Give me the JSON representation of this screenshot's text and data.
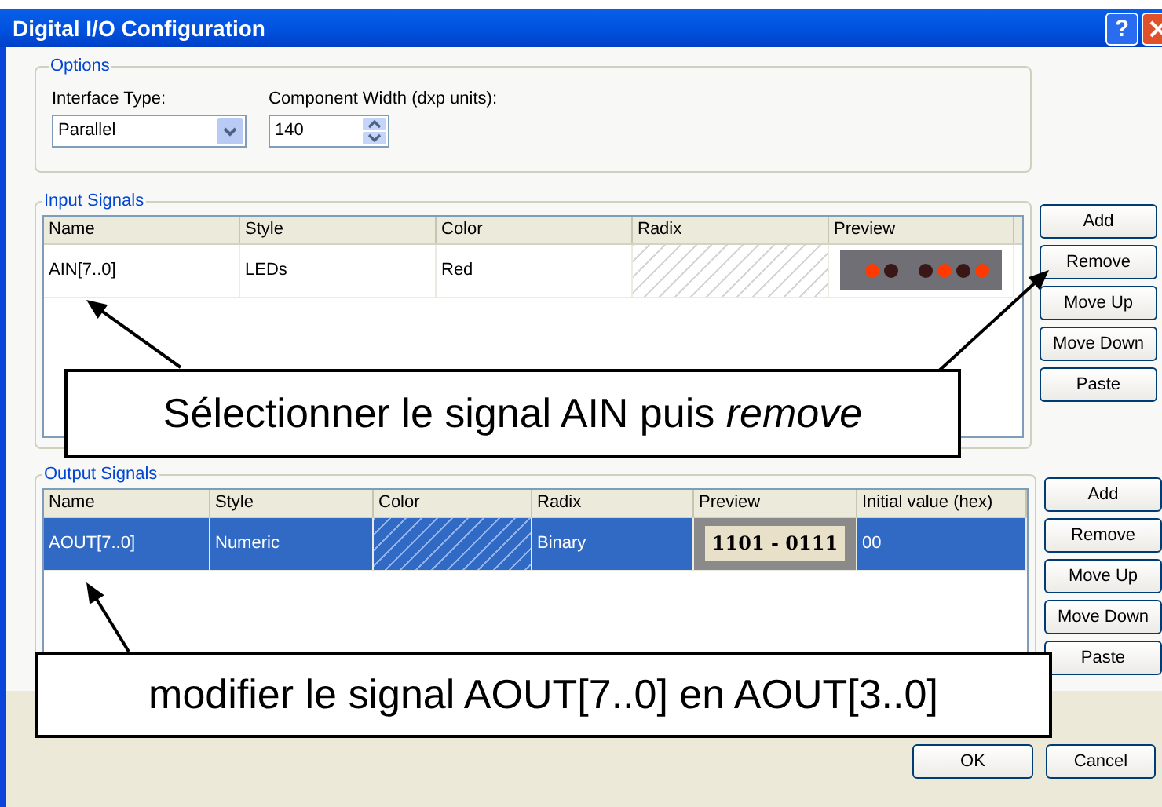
{
  "window": {
    "title": "Digital I/O Configuration",
    "help": "?"
  },
  "options": {
    "title": "Options",
    "interface_type": {
      "label": "Interface Type:",
      "value": "Parallel"
    },
    "component_width": {
      "label": "Component Width (dxp units):",
      "value": "140"
    }
  },
  "input_signals": {
    "title": "Input Signals",
    "columns": [
      "Name",
      "Style",
      "Color",
      "Radix",
      "Preview"
    ],
    "rows": [
      {
        "selected": false,
        "cells": [
          {
            "kind": "text",
            "text": "AIN[7..0]"
          },
          {
            "kind": "text",
            "text": "LEDs"
          },
          {
            "kind": "text",
            "text": "Red"
          },
          {
            "kind": "hatch"
          },
          {
            "kind": "leds",
            "leds": [
              {
                "on": true
              },
              {
                "on": false
              },
              {
                "on": false
              },
              {
                "on": true
              },
              {
                "on": false
              },
              {
                "on": true
              }
            ]
          }
        ]
      }
    ],
    "buttons": [
      "Add",
      "Remove",
      "Move Up",
      "Move Down",
      "Paste"
    ]
  },
  "output_signals": {
    "title": "Output Signals",
    "columns": [
      "Name",
      "Style",
      "Color",
      "Radix",
      "Preview",
      "Initial value (hex)"
    ],
    "rows": [
      {
        "selected": true,
        "cells": [
          {
            "kind": "text",
            "text": "AOUT[7..0]"
          },
          {
            "kind": "text",
            "text": "Numeric"
          },
          {
            "kind": "hatch"
          },
          {
            "kind": "text",
            "text": "Binary"
          },
          {
            "kind": "numeric",
            "text": "1101 - 0111"
          },
          {
            "kind": "text",
            "text": "00"
          }
        ]
      }
    ],
    "buttons": [
      "Add",
      "Remove",
      "Move Up",
      "Move Down",
      "Paste"
    ]
  },
  "footer_buttons": [
    "OK",
    "Cancel"
  ],
  "callouts": [
    {
      "text": "Sélectionner le signal AIN puis *remove*"
    },
    {
      "text": "modifier le signal AOUT[7..0] en AOUT[3..0]"
    }
  ]
}
